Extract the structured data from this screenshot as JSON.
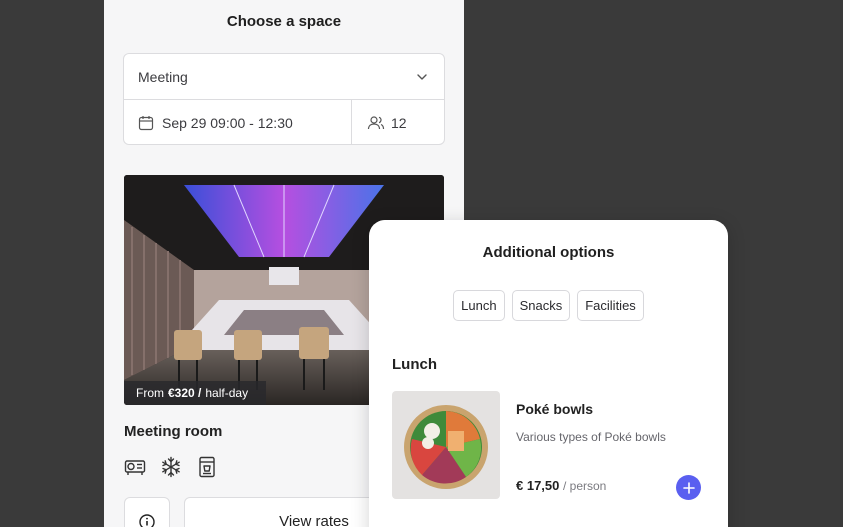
{
  "space_card": {
    "title": "Choose a space",
    "space_type": "Meeting",
    "date_range": "Sep 29 09:00 - 12:30",
    "guests": "12",
    "price_prefix": "From",
    "price_value": "€320 /",
    "price_unit": "half-day",
    "room_name": "Meeting room",
    "amenities": [
      "projector-icon",
      "snowflake-icon",
      "coffee-machine-icon"
    ],
    "view_rates_label": "View rates"
  },
  "options_card": {
    "title": "Additional options",
    "chips": [
      "Lunch",
      "Snacks",
      "Facilities"
    ],
    "section_title": "Lunch",
    "item": {
      "name": "Poké bowls",
      "description": "Various types of Poké bowls",
      "price": "€ 17,50",
      "unit": "/ person"
    }
  },
  "colors": {
    "background": "#3a3a3a",
    "accent": "#5a5ff0"
  }
}
